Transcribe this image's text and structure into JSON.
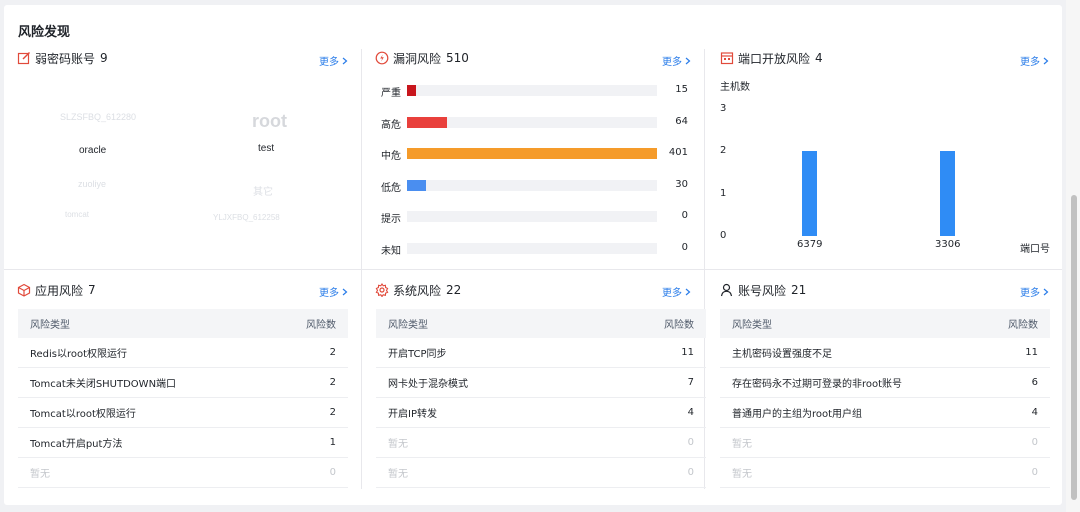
{
  "page": {
    "title": "风险发现"
  },
  "more_label": "更多",
  "weak_password": {
    "title": "弱密码账号",
    "count": "9",
    "words": [
      {
        "text": "SLZSFBQ_612280",
        "weight": 0.2
      },
      {
        "text": "root",
        "weight": 0.35
      },
      {
        "text": "oracle",
        "weight": 1
      },
      {
        "text": "test",
        "weight": 1
      },
      {
        "text": "zuoliye",
        "weight": 0.25
      },
      {
        "text": "其它",
        "weight": 0.3
      },
      {
        "text": "tomcat",
        "weight": 0.2
      },
      {
        "text": "YLJXFBQ_612258",
        "weight": 0.2
      }
    ]
  },
  "vulnerability": {
    "title": "漏洞风险",
    "count": "510",
    "max": 401,
    "items": [
      {
        "label": "严重",
        "value": 15,
        "color": "#c8161d"
      },
      {
        "label": "高危",
        "value": 64,
        "color": "#e9403c"
      },
      {
        "label": "中危",
        "value": 401,
        "color": "#f59b2a"
      },
      {
        "label": "低危",
        "value": 30,
        "color": "#4a8ef0"
      },
      {
        "label": "提示",
        "value": 0,
        "color": "#4a8ef0"
      },
      {
        "label": "未知",
        "value": 0,
        "color": "#4a8ef0"
      }
    ]
  },
  "port": {
    "title": "端口开放风险",
    "count": "4",
    "chart_data": {
      "type": "bar",
      "ylabel": "主机数",
      "xlabel": "端口号",
      "categories": [
        "6379",
        "3306"
      ],
      "values": [
        2,
        2
      ],
      "ylim": [
        0,
        3
      ],
      "yticks": [
        0,
        1,
        2,
        3
      ],
      "bar_color": "#2f8cf5"
    }
  },
  "app_risk": {
    "title": "应用风险",
    "count": "7",
    "header": [
      "风险类型",
      "风险数"
    ],
    "rows": [
      {
        "name": "Redis以root权限运行",
        "value": "2",
        "empty": false
      },
      {
        "name": "Tomcat未关闭SHUTDOWN端口",
        "value": "2",
        "empty": false
      },
      {
        "name": "Tomcat以root权限运行",
        "value": "2",
        "empty": false
      },
      {
        "name": "Tomcat开启put方法",
        "value": "1",
        "empty": false
      },
      {
        "name": "暂无",
        "value": "0",
        "empty": true
      }
    ]
  },
  "sys_risk": {
    "title": "系统风险",
    "count": "22",
    "header": [
      "风险类型",
      "风险数"
    ],
    "rows": [
      {
        "name": "开启TCP同步",
        "value": "11",
        "empty": false
      },
      {
        "name": "网卡处于混杂模式",
        "value": "7",
        "empty": false
      },
      {
        "name": "开启IP转发",
        "value": "4",
        "empty": false
      },
      {
        "name": "暂无",
        "value": "0",
        "empty": true
      },
      {
        "name": "暂无",
        "value": "0",
        "empty": true
      }
    ]
  },
  "account_risk": {
    "title": "账号风险",
    "count": "21",
    "header": [
      "风险类型",
      "风险数"
    ],
    "rows": [
      {
        "name": "主机密码设置强度不足",
        "value": "11",
        "empty": false
      },
      {
        "name": "存在密码永不过期可登录的非root账号",
        "value": "6",
        "empty": false
      },
      {
        "name": "普通用户的主组为root用户组",
        "value": "4",
        "empty": false
      },
      {
        "name": "暂无",
        "value": "0",
        "empty": true
      },
      {
        "name": "暂无",
        "value": "0",
        "empty": true
      }
    ]
  }
}
